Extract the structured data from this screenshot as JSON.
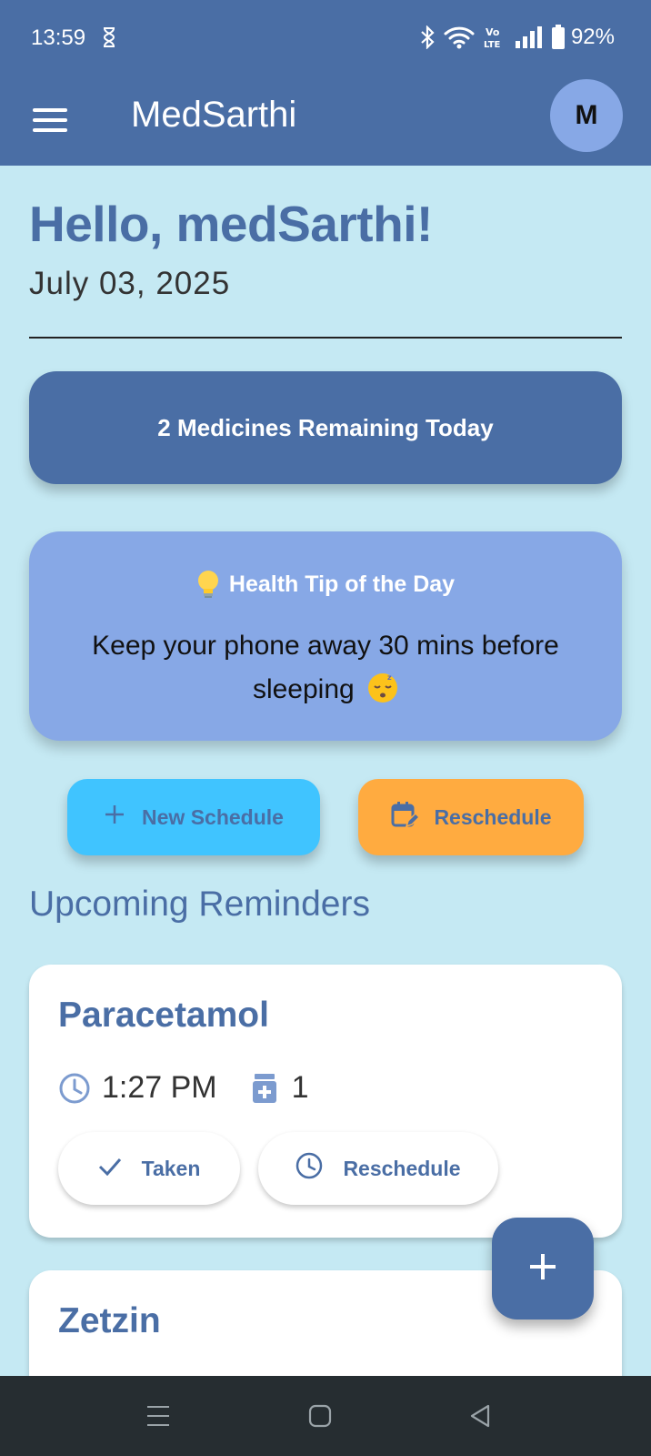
{
  "status_bar": {
    "time": "13:59",
    "battery": "92%",
    "icons": [
      "hourglass-icon",
      "bluetooth-icon",
      "wifi-icon",
      "volte-icon",
      "signal-icon",
      "battery-icon"
    ]
  },
  "app_bar": {
    "title": "MedSarthi",
    "avatar_initial": "M",
    "color": "#4a6ea5"
  },
  "greeting": {
    "title": "Hello, medSarthi!",
    "date": "July 03, 2025"
  },
  "summary": {
    "remaining_text": "2 Medicines Remaining Today"
  },
  "health_tip": {
    "header": "Health Tip of the Day",
    "text": "Keep your phone away 30 mins before sleeping",
    "icons": [
      "lightbulb-icon",
      "sleepy-face-icon"
    ]
  },
  "actions": {
    "new_schedule": "New Schedule",
    "reschedule": "Reschedule",
    "new_color": "#40c4ff",
    "reschedule_color": "#ffab40"
  },
  "reminders": {
    "title": "Upcoming Reminders",
    "items": [
      {
        "name": "Paracetamol",
        "time": "1:27 PM",
        "dose": "1",
        "taken_label": "Taken",
        "reschedule_label": "Reschedule"
      },
      {
        "name": "Zetzin"
      }
    ]
  },
  "colors": {
    "background": "#c5e9f3",
    "primary": "#4a6ea5",
    "tip_card": "#87a8e6"
  }
}
